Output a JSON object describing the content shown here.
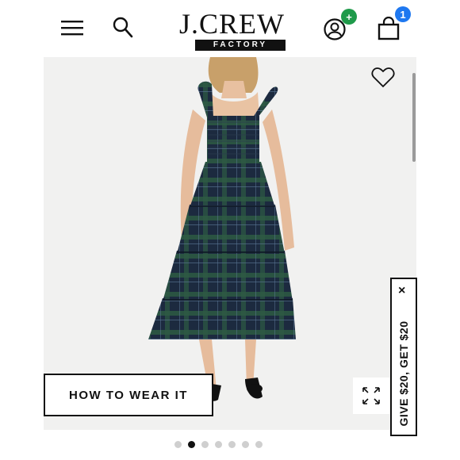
{
  "header": {
    "menu_icon": "hamburger-menu-icon",
    "search_icon": "search-icon",
    "logo_main": "J.CREW",
    "logo_sub": "FACTORY",
    "account_icon": "user-account-icon",
    "account_badge": "+",
    "account_badge_color": "#1f9a4a",
    "bag_icon": "shopping-bag-icon",
    "bag_count": "1",
    "bag_badge_color": "#1e78f0"
  },
  "product": {
    "favorite_icon": "heart-outline-icon",
    "how_to_wear_label": "HOW TO WEAR IT",
    "expand_icon": "expand-arrows-icon",
    "carousel": {
      "count": 7,
      "active_index": 1
    }
  },
  "promo": {
    "label": "GIVE $20, GET $20",
    "close_label": "×"
  },
  "colors": {
    "dress_navy": "#1c2a3f",
    "dress_green": "#2d5a43",
    "background": "#f1f1f0"
  }
}
